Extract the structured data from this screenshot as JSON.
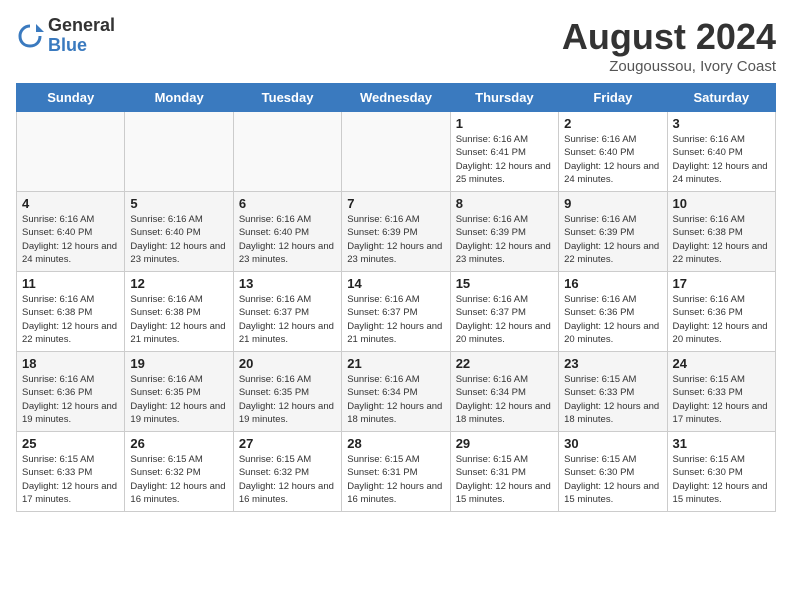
{
  "header": {
    "logo_general": "General",
    "logo_blue": "Blue",
    "title": "August 2024",
    "subtitle": "Zougoussou, Ivory Coast"
  },
  "days_of_week": [
    "Sunday",
    "Monday",
    "Tuesday",
    "Wednesday",
    "Thursday",
    "Friday",
    "Saturday"
  ],
  "weeks": [
    [
      {
        "day": "",
        "info": ""
      },
      {
        "day": "",
        "info": ""
      },
      {
        "day": "",
        "info": ""
      },
      {
        "day": "",
        "info": ""
      },
      {
        "day": "1",
        "info": "Sunrise: 6:16 AM\nSunset: 6:41 PM\nDaylight: 12 hours\nand 25 minutes."
      },
      {
        "day": "2",
        "info": "Sunrise: 6:16 AM\nSunset: 6:40 PM\nDaylight: 12 hours\nand 24 minutes."
      },
      {
        "day": "3",
        "info": "Sunrise: 6:16 AM\nSunset: 6:40 PM\nDaylight: 12 hours\nand 24 minutes."
      }
    ],
    [
      {
        "day": "4",
        "info": "Sunrise: 6:16 AM\nSunset: 6:40 PM\nDaylight: 12 hours\nand 24 minutes."
      },
      {
        "day": "5",
        "info": "Sunrise: 6:16 AM\nSunset: 6:40 PM\nDaylight: 12 hours\nand 23 minutes."
      },
      {
        "day": "6",
        "info": "Sunrise: 6:16 AM\nSunset: 6:40 PM\nDaylight: 12 hours\nand 23 minutes."
      },
      {
        "day": "7",
        "info": "Sunrise: 6:16 AM\nSunset: 6:39 PM\nDaylight: 12 hours\nand 23 minutes."
      },
      {
        "day": "8",
        "info": "Sunrise: 6:16 AM\nSunset: 6:39 PM\nDaylight: 12 hours\nand 23 minutes."
      },
      {
        "day": "9",
        "info": "Sunrise: 6:16 AM\nSunset: 6:39 PM\nDaylight: 12 hours\nand 22 minutes."
      },
      {
        "day": "10",
        "info": "Sunrise: 6:16 AM\nSunset: 6:38 PM\nDaylight: 12 hours\nand 22 minutes."
      }
    ],
    [
      {
        "day": "11",
        "info": "Sunrise: 6:16 AM\nSunset: 6:38 PM\nDaylight: 12 hours\nand 22 minutes."
      },
      {
        "day": "12",
        "info": "Sunrise: 6:16 AM\nSunset: 6:38 PM\nDaylight: 12 hours\nand 21 minutes."
      },
      {
        "day": "13",
        "info": "Sunrise: 6:16 AM\nSunset: 6:37 PM\nDaylight: 12 hours\nand 21 minutes."
      },
      {
        "day": "14",
        "info": "Sunrise: 6:16 AM\nSunset: 6:37 PM\nDaylight: 12 hours\nand 21 minutes."
      },
      {
        "day": "15",
        "info": "Sunrise: 6:16 AM\nSunset: 6:37 PM\nDaylight: 12 hours\nand 20 minutes."
      },
      {
        "day": "16",
        "info": "Sunrise: 6:16 AM\nSunset: 6:36 PM\nDaylight: 12 hours\nand 20 minutes."
      },
      {
        "day": "17",
        "info": "Sunrise: 6:16 AM\nSunset: 6:36 PM\nDaylight: 12 hours\nand 20 minutes."
      }
    ],
    [
      {
        "day": "18",
        "info": "Sunrise: 6:16 AM\nSunset: 6:36 PM\nDaylight: 12 hours\nand 19 minutes."
      },
      {
        "day": "19",
        "info": "Sunrise: 6:16 AM\nSunset: 6:35 PM\nDaylight: 12 hours\nand 19 minutes."
      },
      {
        "day": "20",
        "info": "Sunrise: 6:16 AM\nSunset: 6:35 PM\nDaylight: 12 hours\nand 19 minutes."
      },
      {
        "day": "21",
        "info": "Sunrise: 6:16 AM\nSunset: 6:34 PM\nDaylight: 12 hours\nand 18 minutes."
      },
      {
        "day": "22",
        "info": "Sunrise: 6:16 AM\nSunset: 6:34 PM\nDaylight: 12 hours\nand 18 minutes."
      },
      {
        "day": "23",
        "info": "Sunrise: 6:15 AM\nSunset: 6:33 PM\nDaylight: 12 hours\nand 18 minutes."
      },
      {
        "day": "24",
        "info": "Sunrise: 6:15 AM\nSunset: 6:33 PM\nDaylight: 12 hours\nand 17 minutes."
      }
    ],
    [
      {
        "day": "25",
        "info": "Sunrise: 6:15 AM\nSunset: 6:33 PM\nDaylight: 12 hours\nand 17 minutes."
      },
      {
        "day": "26",
        "info": "Sunrise: 6:15 AM\nSunset: 6:32 PM\nDaylight: 12 hours\nand 16 minutes."
      },
      {
        "day": "27",
        "info": "Sunrise: 6:15 AM\nSunset: 6:32 PM\nDaylight: 12 hours\nand 16 minutes."
      },
      {
        "day": "28",
        "info": "Sunrise: 6:15 AM\nSunset: 6:31 PM\nDaylight: 12 hours\nand 16 minutes."
      },
      {
        "day": "29",
        "info": "Sunrise: 6:15 AM\nSunset: 6:31 PM\nDaylight: 12 hours\nand 15 minutes."
      },
      {
        "day": "30",
        "info": "Sunrise: 6:15 AM\nSunset: 6:30 PM\nDaylight: 12 hours\nand 15 minutes."
      },
      {
        "day": "31",
        "info": "Sunrise: 6:15 AM\nSunset: 6:30 PM\nDaylight: 12 hours\nand 15 minutes."
      }
    ]
  ]
}
